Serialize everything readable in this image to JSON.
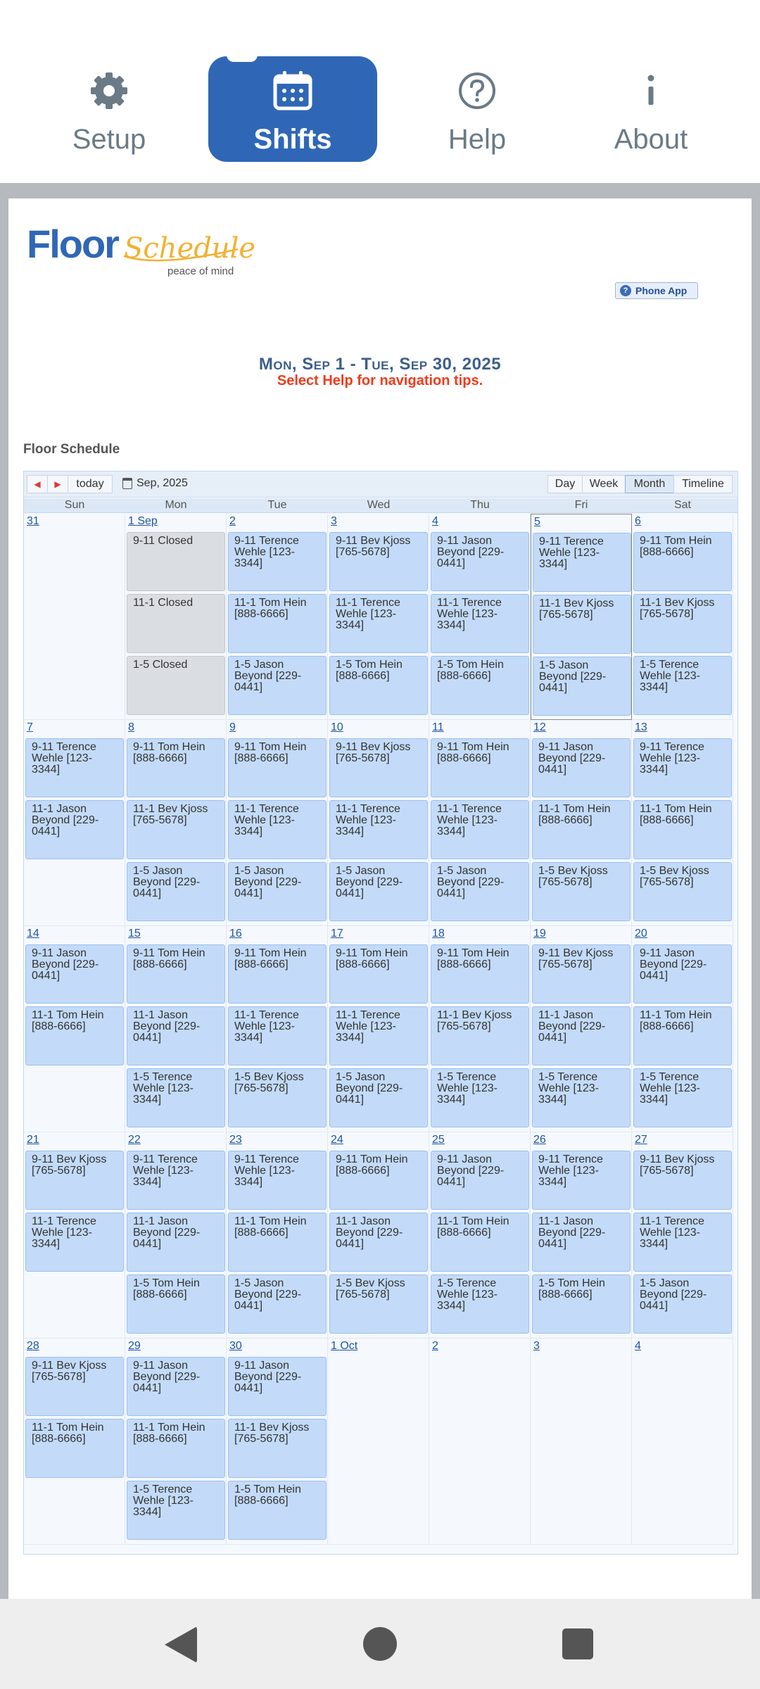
{
  "tabs": {
    "setup": "Setup",
    "shifts": "Shifts",
    "help": "Help",
    "about": "About"
  },
  "logo": {
    "word1": "Floor",
    "word2": "Schedule",
    "tagline": "peace of mind"
  },
  "phone_app": "Phone App",
  "date_range": "Mon, Sep 1 - Tue, Sep 30, 2025",
  "help_tip": "Select Help for navigation tips.",
  "section_title": "Floor Schedule",
  "toolbar": {
    "today": "today",
    "month_label": "Sep, 2025",
    "views": [
      "Day",
      "Week",
      "Month",
      "Timeline"
    ],
    "selected_view": "Month"
  },
  "weekdays": [
    "Sun",
    "Mon",
    "Tue",
    "Wed",
    "Thu",
    "Fri",
    "Sat"
  ],
  "weeks": [
    [
      {
        "day": "31",
        "events": []
      },
      {
        "day": "1 Sep",
        "events": [
          {
            "t": "9-11 Closed",
            "closed": true
          },
          {
            "t": "11-1 Closed",
            "closed": true
          },
          {
            "t": "1-5 Closed",
            "closed": true
          }
        ]
      },
      {
        "day": "2",
        "events": [
          {
            "t": "9-11 Terence Wehle [123-3344]"
          },
          {
            "t": "11-1 Tom Hein [888-6666]"
          },
          {
            "t": "1-5 Jason Beyond [229-0441]"
          }
        ]
      },
      {
        "day": "3",
        "events": [
          {
            "t": "9-11 Bev Kjoss [765-5678]"
          },
          {
            "t": "11-1 Terence Wehle [123-3344]"
          },
          {
            "t": "1-5 Tom Hein [888-6666]"
          }
        ]
      },
      {
        "day": "4",
        "events": [
          {
            "t": "9-11 Jason Beyond [229-0441]"
          },
          {
            "t": "11-1 Terence Wehle [123-3344]"
          },
          {
            "t": "1-5 Tom Hein [888-6666]"
          }
        ]
      },
      {
        "day": "5",
        "today": true,
        "events": [
          {
            "t": "9-11 Terence Wehle [123-3344]"
          },
          {
            "t": "11-1 Bev Kjoss [765-5678]"
          },
          {
            "t": "1-5 Jason Beyond [229-0441]"
          }
        ]
      },
      {
        "day": "6",
        "events": [
          {
            "t": "9-11 Tom Hein [888-6666]"
          },
          {
            "t": "11-1 Bev Kjoss [765-5678]"
          },
          {
            "t": "1-5 Terence Wehle [123-3344]"
          }
        ]
      }
    ],
    [
      {
        "day": "7",
        "events": [
          {
            "t": "9-11 Terence Wehle [123-3344]"
          },
          {
            "t": "11-1 Jason Beyond [229-0441]"
          }
        ]
      },
      {
        "day": "8",
        "events": [
          {
            "t": "9-11 Tom Hein [888-6666]"
          },
          {
            "t": "11-1 Bev Kjoss [765-5678]"
          },
          {
            "t": "1-5 Jason Beyond [229-0441]"
          }
        ]
      },
      {
        "day": "9",
        "events": [
          {
            "t": "9-11 Tom Hein [888-6666]"
          },
          {
            "t": "11-1 Terence Wehle [123-3344]"
          },
          {
            "t": "1-5 Jason Beyond [229-0441]"
          }
        ]
      },
      {
        "day": "10",
        "events": [
          {
            "t": "9-11 Bev Kjoss [765-5678]"
          },
          {
            "t": "11-1 Terence Wehle [123-3344]"
          },
          {
            "t": "1-5 Jason Beyond [229-0441]"
          }
        ]
      },
      {
        "day": "11",
        "events": [
          {
            "t": "9-11 Tom Hein [888-6666]"
          },
          {
            "t": "11-1 Terence Wehle [123-3344]"
          },
          {
            "t": "1-5 Jason Beyond [229-0441]"
          }
        ]
      },
      {
        "day": "12",
        "events": [
          {
            "t": "9-11 Jason Beyond [229-0441]"
          },
          {
            "t": "11-1 Tom Hein [888-6666]"
          },
          {
            "t": "1-5 Bev Kjoss [765-5678]"
          }
        ]
      },
      {
        "day": "13",
        "events": [
          {
            "t": "9-11 Terence Wehle [123-3344]"
          },
          {
            "t": "11-1 Tom Hein [888-6666]"
          },
          {
            "t": "1-5 Bev Kjoss [765-5678]"
          }
        ]
      }
    ],
    [
      {
        "day": "14",
        "events": [
          {
            "t": "9-11 Jason Beyond [229-0441]"
          },
          {
            "t": "11-1 Tom Hein [888-6666]"
          }
        ]
      },
      {
        "day": "15",
        "events": [
          {
            "t": "9-11 Tom Hein [888-6666]"
          },
          {
            "t": "11-1 Jason Beyond [229-0441]"
          },
          {
            "t": "1-5 Terence Wehle [123-3344]"
          }
        ]
      },
      {
        "day": "16",
        "events": [
          {
            "t": "9-11 Tom Hein [888-6666]"
          },
          {
            "t": "11-1 Terence Wehle [123-3344]"
          },
          {
            "t": "1-5 Bev Kjoss [765-5678]"
          }
        ]
      },
      {
        "day": "17",
        "events": [
          {
            "t": "9-11 Tom Hein [888-6666]"
          },
          {
            "t": "11-1 Terence Wehle [123-3344]"
          },
          {
            "t": "1-5 Jason Beyond [229-0441]"
          }
        ]
      },
      {
        "day": "18",
        "events": [
          {
            "t": "9-11 Tom Hein [888-6666]"
          },
          {
            "t": "11-1 Bev Kjoss [765-5678]"
          },
          {
            "t": "1-5 Terence Wehle [123-3344]"
          }
        ]
      },
      {
        "day": "19",
        "events": [
          {
            "t": "9-11 Bev Kjoss [765-5678]"
          },
          {
            "t": "11-1 Jason Beyond [229-0441]"
          },
          {
            "t": "1-5 Terence Wehle [123-3344]"
          }
        ]
      },
      {
        "day": "20",
        "events": [
          {
            "t": "9-11 Jason Beyond [229-0441]"
          },
          {
            "t": "11-1 Tom Hein [888-6666]"
          },
          {
            "t": "1-5 Terence Wehle [123-3344]"
          }
        ]
      }
    ],
    [
      {
        "day": "21",
        "events": [
          {
            "t": "9-11 Bev Kjoss [765-5678]"
          },
          {
            "t": "11-1 Terence Wehle [123-3344]"
          }
        ]
      },
      {
        "day": "22",
        "events": [
          {
            "t": "9-11 Terence Wehle [123-3344]"
          },
          {
            "t": "11-1 Jason Beyond [229-0441]"
          },
          {
            "t": "1-5 Tom Hein [888-6666]"
          }
        ]
      },
      {
        "day": "23",
        "events": [
          {
            "t": "9-11 Terence Wehle [123-3344]"
          },
          {
            "t": "11-1 Tom Hein [888-6666]"
          },
          {
            "t": "1-5 Jason Beyond [229-0441]"
          }
        ]
      },
      {
        "day": "24",
        "events": [
          {
            "t": "9-11 Tom Hein [888-6666]"
          },
          {
            "t": "11-1 Jason Beyond [229-0441]"
          },
          {
            "t": "1-5 Bev Kjoss [765-5678]"
          }
        ]
      },
      {
        "day": "25",
        "events": [
          {
            "t": "9-11 Jason Beyond [229-0441]"
          },
          {
            "t": "11-1 Tom Hein [888-6666]"
          },
          {
            "t": "1-5 Terence Wehle [123-3344]"
          }
        ]
      },
      {
        "day": "26",
        "events": [
          {
            "t": "9-11 Terence Wehle [123-3344]"
          },
          {
            "t": "11-1 Jason Beyond [229-0441]"
          },
          {
            "t": "1-5 Tom Hein [888-6666]"
          }
        ]
      },
      {
        "day": "27",
        "events": [
          {
            "t": "9-11 Bev Kjoss [765-5678]"
          },
          {
            "t": "11-1 Terence Wehle [123-3344]"
          },
          {
            "t": "1-5 Jason Beyond [229-0441]"
          }
        ]
      }
    ],
    [
      {
        "day": "28",
        "events": [
          {
            "t": "9-11 Bev Kjoss [765-5678]"
          },
          {
            "t": "11-1 Tom Hein [888-6666]"
          }
        ]
      },
      {
        "day": "29",
        "events": [
          {
            "t": "9-11 Jason Beyond [229-0441]"
          },
          {
            "t": "11-1 Tom Hein [888-6666]"
          },
          {
            "t": "1-5 Terence Wehle [123-3344]"
          }
        ]
      },
      {
        "day": "30",
        "events": [
          {
            "t": "9-11 Jason Beyond [229-0441]"
          },
          {
            "t": "11-1 Bev Kjoss [765-5678]"
          },
          {
            "t": "1-5 Tom Hein [888-6666]"
          }
        ]
      },
      {
        "day": "1 Oct",
        "events": []
      },
      {
        "day": "2",
        "events": []
      },
      {
        "day": "3",
        "events": []
      },
      {
        "day": "4",
        "events": []
      }
    ]
  ],
  "colors": {
    "accent": "#2f67b6",
    "event_bg": "#c3dbf8",
    "closed_bg": "#dadde2",
    "tip": "#ef3b1d"
  },
  "nav": {
    "back": "back-icon",
    "home": "home-icon",
    "recents": "recents-icon"
  }
}
